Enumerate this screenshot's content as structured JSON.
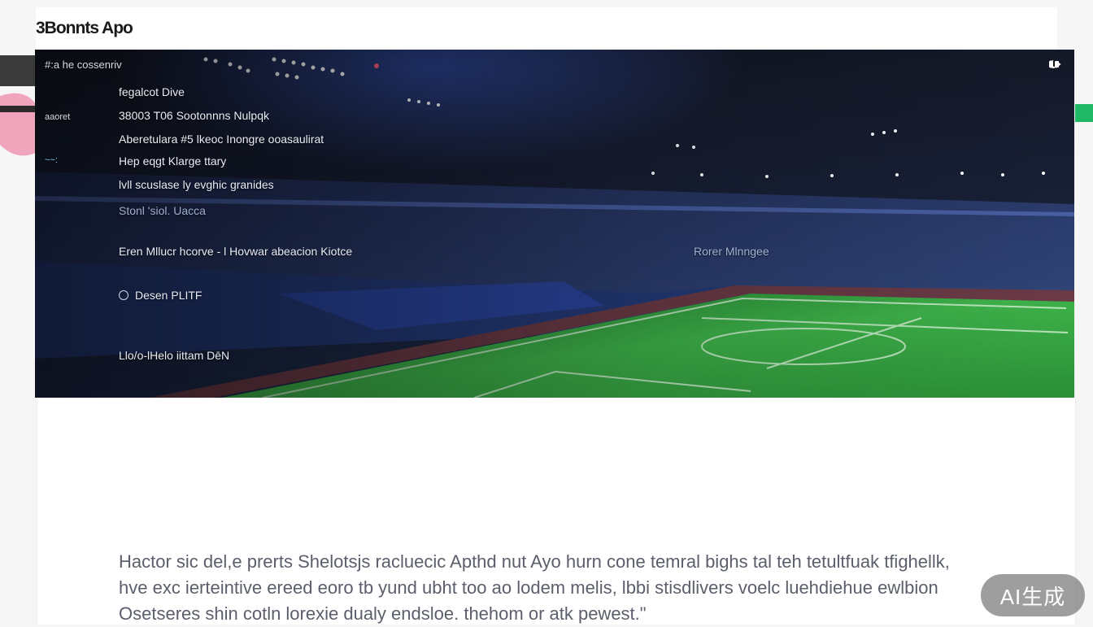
{
  "app": {
    "title": "3Bonnts Apo"
  },
  "hero": {
    "header_label": "#:a he cossenriv",
    "side_labels": [
      "aaoret",
      "~~:"
    ],
    "lines": [
      "fegalcot Dive",
      "38003 T06 Sootonnns Nulpqk",
      "Aberetulara #5 lkeoc Inongre ooasaulirat",
      "Hep eqgt Klarge ttary",
      "lvll scuslase ly evghic granides",
      "Stonl 'siol. Uacca",
      "Eren Mllucr hcorve - l Hovwar abeacion Kiotce",
      "Rorer Mlnngee",
      "Desen PLITF",
      "Llo/o-lHelo iittam DēN"
    ],
    "icons": [
      "settings-toggle-icon",
      "theme-icon",
      "overflow-icon"
    ]
  },
  "content": {
    "paragraph": "Hactor sic del,e prerts Shelotsjs racluecic Apthd nut Ayo hurn cone temral bighs tal teh tetultfuak tfighellk, hve exc ierteintive ereed eoro tb yund ubht too ao lodem melis, lbbi stisdlivers voelc luehdiehue ewlbion Osetseres shin cotln lorexie dualy endsloe. thehom or atk pewest.\""
  },
  "badge": {
    "label": "AI生成"
  },
  "colors": {
    "accent_green": "#1fb866",
    "pitch": "#2f9b3a",
    "stadium_blue": "#2a3f8c"
  }
}
